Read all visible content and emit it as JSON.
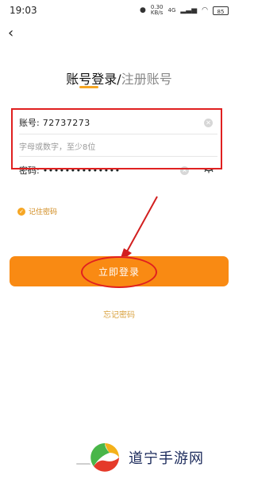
{
  "status_bar": {
    "time": "19:03",
    "network_speed": "0.30\nKB/s",
    "signal_4g": "4G",
    "wifi": "wifi-icon",
    "battery": "85"
  },
  "nav": {
    "back_icon": "back-chevron-icon"
  },
  "tabs": {
    "active": "账号登录",
    "separator": "/",
    "inactive": "注册账号"
  },
  "form": {
    "account": {
      "label": "账号:",
      "value": "72737273"
    },
    "hint": "字母或数字，至少8位",
    "password": {
      "label": "密码:",
      "value": "••••••••••••••"
    }
  },
  "remember_label": "记住密码",
  "login_button": "立即登录",
  "forgot_password": "忘记密码",
  "watermark": {
    "text": "道宁手游网"
  },
  "colors": {
    "accent": "#f98a13",
    "highlight": "#e02020"
  }
}
